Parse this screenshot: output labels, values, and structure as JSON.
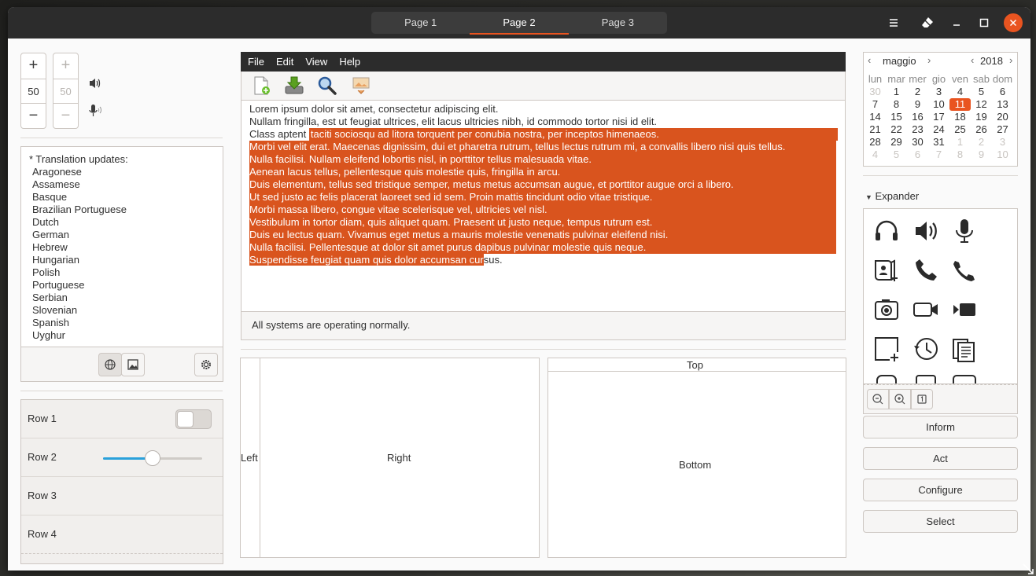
{
  "header": {
    "tabs": [
      {
        "label": "Page 1"
      },
      {
        "label": "Page 2"
      },
      {
        "label": "Page 3"
      }
    ],
    "active_tab": "Page 2"
  },
  "colors": {
    "accent": "#e95420",
    "selection": "#d9541e",
    "headerbar": "#2c2c2c",
    "slider": "#2aa1db"
  },
  "spinners": [
    {
      "value": "50",
      "enabled": true
    },
    {
      "value": "50",
      "enabled": false
    }
  ],
  "translation_list": {
    "title": "* Translation updates:",
    "items": [
      "Aragonese",
      "Assamese",
      "Basque",
      "Brazilian Portuguese",
      "Dutch",
      "German",
      "Hebrew",
      "Hungarian",
      "Polish",
      "Portuguese",
      "Serbian",
      "Slovenian",
      "Spanish",
      "Uyghur"
    ]
  },
  "rows": {
    "row1": "Row 1",
    "row2": "Row 2",
    "row3": "Row 3",
    "row4": "Row 4",
    "slider_value": 0.5
  },
  "menubar": {
    "file": "File",
    "edit": "Edit",
    "view": "View",
    "help": "Help"
  },
  "textview": {
    "line1": "Lorem ipsum dolor sit amet, consectetur adipiscing elit.",
    "line2": "Nullam fringilla, est ut feugiat ultrices, elit lacus ultricies nibh, id commodo tortor nisi id elit.",
    "line3a": "Class aptent ",
    "line3b": "taciti sociosqu ad litora torquent per conubia nostra, per inceptos himenaeos.",
    "line4": "Morbi vel elit erat. Maecenas dignissim, dui et pharetra rutrum, tellus lectus rutrum mi, a convallis libero nisi quis tellus.",
    "line5": "Nulla facilisi. Nullam eleifend lobortis nisl, in porttitor tellus malesuada vitae.",
    "line6": "Aenean lacus tellus, pellentesque quis molestie quis, fringilla in arcu.",
    "line7": "Duis elementum, tellus sed tristique semper, metus metus accumsan augue, et porttitor augue orci a libero.",
    "line8": "Ut sed justo ac felis placerat laoreet sed id sem. Proin mattis tincidunt odio vitae tristique.",
    "line9": "Morbi massa libero, congue vitae scelerisque vel, ultricies vel nisl.",
    "line10": "Vestibulum in tortor diam, quis aliquet quam. Praesent ut justo neque, tempus rutrum est.",
    "line11": "Duis eu lectus quam. Vivamus eget metus a mauris molestie venenatis pulvinar eleifend nisi.",
    "line12": "Nulla facilisi. Pellentesque at dolor sit amet purus dapibus pulvinar molestie quis neque.",
    "line13a": "Suspendisse feugiat quam quis dolor accumsan cur",
    "line13b": "sus."
  },
  "status": "All systems are operating normally.",
  "panes": {
    "left": "Left",
    "right": "Right",
    "top": "Top",
    "bottom": "Bottom"
  },
  "calendar": {
    "month": "maggio",
    "year": "2018",
    "weekdays": [
      "lun",
      "mar",
      "mer",
      "gio",
      "ven",
      "sab",
      "dom"
    ],
    "weeks": [
      [
        "30",
        "1",
        "2",
        "3",
        "4",
        "5",
        "6"
      ],
      [
        "7",
        "8",
        "9",
        "10",
        "11",
        "12",
        "13"
      ],
      [
        "14",
        "15",
        "16",
        "17",
        "18",
        "19",
        "20"
      ],
      [
        "21",
        "22",
        "23",
        "24",
        "25",
        "26",
        "27"
      ],
      [
        "28",
        "29",
        "30",
        "31",
        "1",
        "2",
        "3"
      ],
      [
        "4",
        "5",
        "6",
        "7",
        "8",
        "9",
        "10"
      ]
    ],
    "selected_day": "11"
  },
  "expander": {
    "label": "Expander"
  },
  "icons": [
    "headphones-icon",
    "speaker-icon",
    "microphone-icon",
    "address-book-icon",
    "phone-icon",
    "hangup-icon",
    "camera-icon",
    "video-camera-icon",
    "video-icon",
    "new-window-icon",
    "history-icon",
    "documents-icon"
  ],
  "actions": {
    "inform": "Inform",
    "act": "Act",
    "configure": "Configure",
    "select": "Select"
  }
}
